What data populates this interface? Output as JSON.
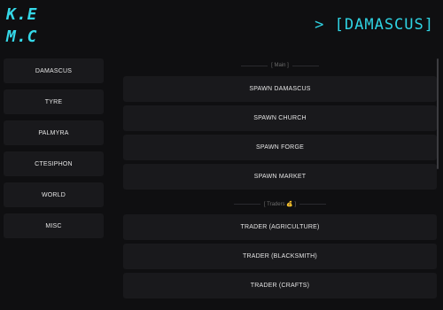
{
  "logo": {
    "line1": "K.E",
    "line2": "M.C"
  },
  "header": {
    "title": "> [DAMASCUS]"
  },
  "sidebar": {
    "items": [
      {
        "label": "DAMASCUS"
      },
      {
        "label": "TYRE"
      },
      {
        "label": "PALMYRA"
      },
      {
        "label": "CTESIPHON"
      },
      {
        "label": "WORLD"
      },
      {
        "label": "MISC"
      }
    ]
  },
  "main": {
    "sections": [
      {
        "label": "[ Main ]",
        "buttons": [
          "SPAWN DAMASCUS",
          "SPAWN CHURCH",
          "SPAWN FORGE",
          "SPAWN MARKET"
        ]
      },
      {
        "label": "[ Traders 💰 ]",
        "buttons": [
          "TRADER (AGRICULTURE)",
          "TRADER (BLACKSMITH)",
          "TRADER (CRAFTS)"
        ]
      }
    ]
  }
}
